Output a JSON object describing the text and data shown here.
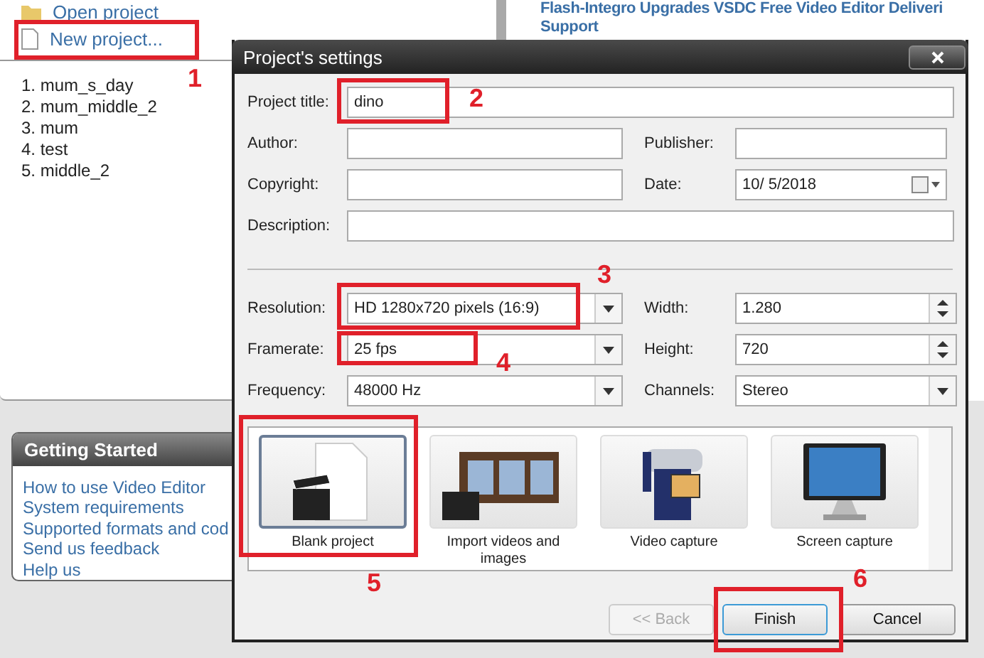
{
  "start_menu": {
    "items": [
      {
        "label": "Open project",
        "kind": "open"
      },
      {
        "label": "New project...",
        "kind": "new"
      }
    ],
    "recent": [
      "1. mum_s_day",
      "2. mum_middle_2",
      "3. mum",
      "4. test",
      "5. middle_2"
    ]
  },
  "news": {
    "headline": "Flash-Integro Upgrades VSDC Free Video Editor Deliveri",
    "subline": "Support"
  },
  "getting_started": {
    "title": "Getting Started",
    "links": [
      "How to use Video Editor",
      "System requirements",
      "Supported formats and cod",
      "Send us feedback",
      "Help us"
    ]
  },
  "dialog": {
    "title": "Project's settings",
    "title_field": {
      "label": "Project title:",
      "value": "dino"
    },
    "meta_rows": [
      {
        "left": {
          "label": "Author:",
          "kind": "text"
        },
        "right": {
          "label": "Publisher:",
          "kind": "text"
        }
      },
      {
        "left": {
          "label": "Copyright:",
          "kind": "text"
        },
        "right": {
          "label": "Date:",
          "value": "10/ 5/2018",
          "kind": "date"
        }
      }
    ],
    "description": {
      "label": "Description:"
    },
    "video_rows": [
      {
        "left": {
          "label": "Resolution:",
          "value": "HD 1280x720 pixels (16:9)",
          "kind": "dropdown"
        },
        "right": {
          "label": "Width:",
          "value": "1.280",
          "kind": "spinner"
        }
      },
      {
        "left": {
          "label": "Framerate:",
          "value": "25 fps",
          "kind": "dropdown"
        },
        "right": {
          "label": "Height:",
          "value": "720",
          "kind": "spinner"
        }
      },
      {
        "left": {
          "label": "Frequency:",
          "value": "48000 Hz",
          "kind": "dropdown"
        },
        "right": {
          "label": "Channels:",
          "value": "Stereo",
          "kind": "dropdown"
        }
      }
    ],
    "tiles": [
      {
        "label": "Blank project",
        "kind": "blank",
        "selected": true
      },
      {
        "label": "Import videos and images",
        "kind": "import",
        "selected": false
      },
      {
        "label": "Video capture",
        "kind": "camera",
        "selected": false
      },
      {
        "label": "Screen capture",
        "kind": "screen",
        "selected": false
      }
    ],
    "buttons": [
      {
        "label": "<< Back",
        "disabled": true,
        "default": false
      },
      {
        "label": "Finish",
        "disabled": false,
        "default": true
      },
      {
        "label": "Cancel",
        "disabled": false,
        "default": false
      }
    ]
  },
  "annotations": [
    "1",
    "2",
    "3",
    "4",
    "5",
    "6"
  ]
}
